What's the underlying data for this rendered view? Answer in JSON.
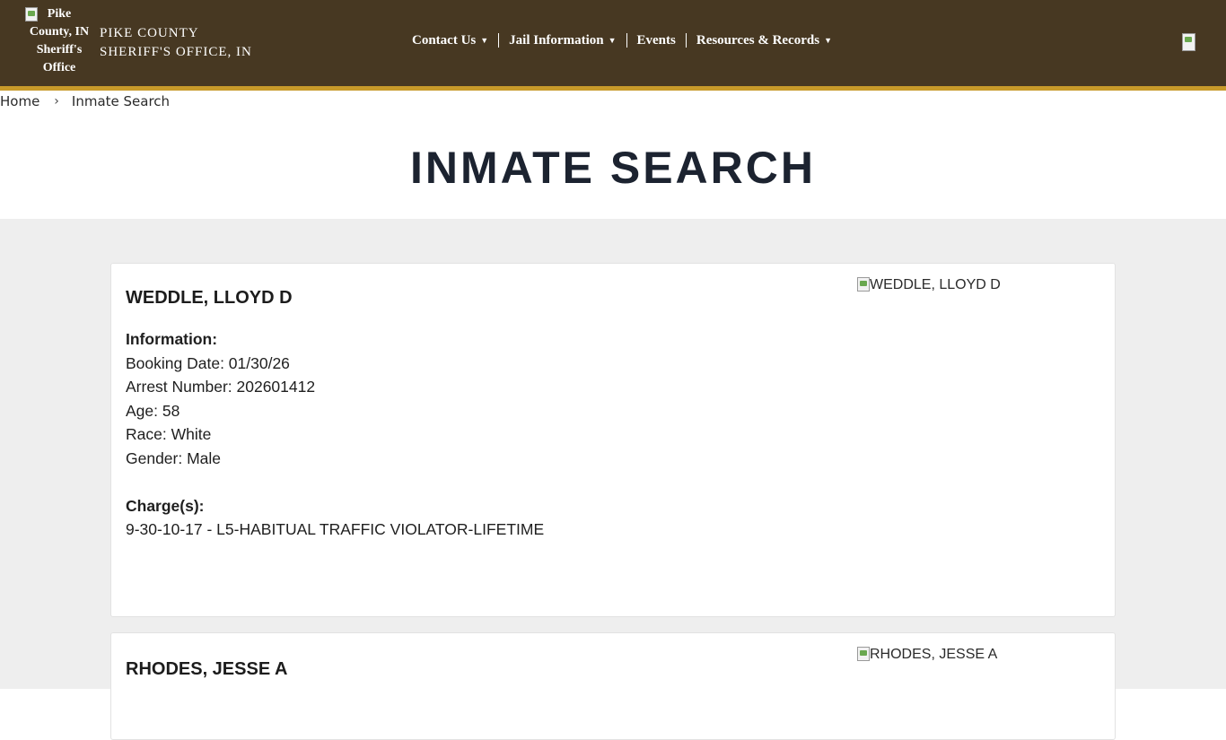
{
  "header": {
    "logo_alt": "Pike County, IN Sheriff's Office",
    "site_name_line1": "PIKE COUNTY",
    "site_name_line2": "SHERIFF'S OFFICE, IN",
    "nav": [
      {
        "label": "Contact Us",
        "dropdown": true
      },
      {
        "label": "Jail Information",
        "dropdown": true
      },
      {
        "label": "Events",
        "dropdown": false
      },
      {
        "label": "Resources & Records",
        "dropdown": true
      }
    ],
    "colors": {
      "background": "#473822",
      "accent": "#c89a2a"
    }
  },
  "breadcrumb": {
    "home": "Home",
    "separator": "›",
    "current": "Inmate Search"
  },
  "page_title": "INMATE SEARCH",
  "inmates": [
    {
      "name": "WEDDLE, LLOYD D",
      "photo_alt": "WEDDLE, LLOYD D",
      "info_heading": "Information:",
      "booking_date": "Booking Date: 01/30/26",
      "arrest_number": "Arrest Number: 202601412",
      "age": "Age: 58",
      "race": "Race: White",
      "gender": "Gender: Male",
      "charges_heading": "Charge(s):",
      "charges": [
        "9-30-10-17 - L5-HABITUAL TRAFFIC VIOLATOR-LIFETIME"
      ]
    },
    {
      "name": "RHODES, JESSE A",
      "photo_alt": "RHODES, JESSE A"
    }
  ]
}
